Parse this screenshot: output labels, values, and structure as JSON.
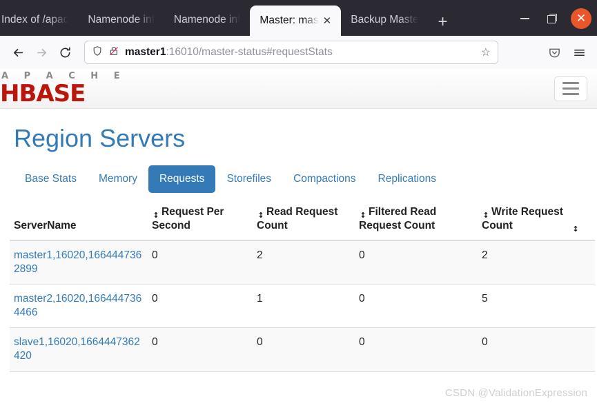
{
  "browser": {
    "tabs": [
      {
        "title": "Index of /apac",
        "active": false
      },
      {
        "title": "Namenode inf",
        "active": false
      },
      {
        "title": "Namenode inf",
        "active": false
      },
      {
        "title": "Master: mas",
        "active": true
      },
      {
        "title": "Backup Maste",
        "active": false
      }
    ],
    "new_tab_label": "+",
    "tab_close_label": "✕",
    "window_controls": {
      "minimize": "minimize-button",
      "restore": "restore-button",
      "close": "✕"
    },
    "nav": {
      "back": "←",
      "forward": "→",
      "reload": "⟳"
    },
    "url": {
      "host": "master1",
      "path": ":16010/master-status#requestStats",
      "full": "master1:16010/master-status#requestStats",
      "shield_icon": "shield-icon",
      "lock_icon": "lock-crossed-icon",
      "bookmark_icon": "☆"
    },
    "toolbar_right": {
      "pocket_icon": "pocket-icon",
      "menu_icon": "hamburger-menu-icon"
    }
  },
  "site": {
    "logo": {
      "apache": "A P A C H E",
      "hbase": "HBASE",
      "apache_color": "#8b8b8b",
      "hbase_color": "#ba160c"
    },
    "menu_toggle": "navbar-toggle"
  },
  "main": {
    "page_title": "Region Servers",
    "accent_color": "#337ab7",
    "tabs": [
      {
        "label": "Base Stats",
        "active": false
      },
      {
        "label": "Memory",
        "active": false
      },
      {
        "label": "Requests",
        "active": true
      },
      {
        "label": "Storefiles",
        "active": false
      },
      {
        "label": "Compactions",
        "active": false
      },
      {
        "label": "Replications",
        "active": false
      }
    ],
    "table": {
      "columns": [
        "ServerName",
        "Request Per Second",
        "Read Request Count",
        "Filtered Read Request Count",
        "Write Request Count"
      ],
      "sort_icon": "↕",
      "rows": [
        {
          "server_name": "master1,16020,1664447362899",
          "request_per_second": "0",
          "read_request_count": "2",
          "filtered_read_request_count": "0",
          "write_request_count": "2"
        },
        {
          "server_name": "master2,16020,1664447364466",
          "request_per_second": "0",
          "read_request_count": "1",
          "filtered_read_request_count": "0",
          "write_request_count": "5"
        },
        {
          "server_name": "slave1,16020,1664447362420",
          "request_per_second": "0",
          "read_request_count": "0",
          "filtered_read_request_count": "0",
          "write_request_count": "0"
        }
      ]
    }
  },
  "watermark": "CSDN @ValidationExpression"
}
